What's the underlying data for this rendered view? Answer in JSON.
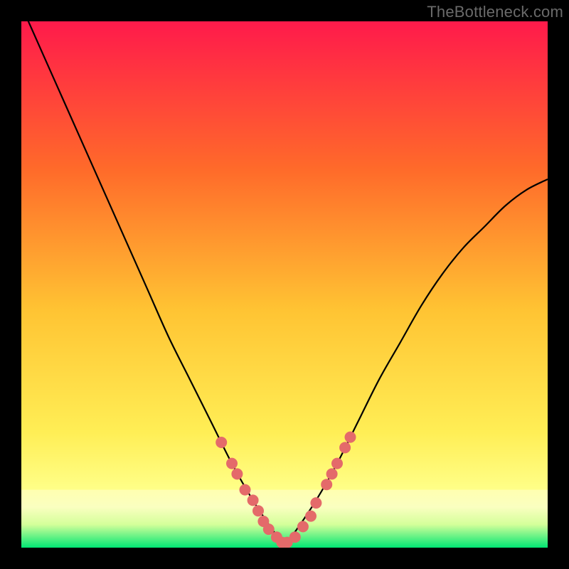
{
  "watermark": "TheBottleneck.com",
  "chart_data": {
    "type": "line",
    "title": "",
    "xlabel": "",
    "ylabel": "",
    "xlim": [
      0,
      100
    ],
    "ylim": [
      0,
      100
    ],
    "background_gradient": {
      "top": "#ff1a4b",
      "mid1": "#ff7a2a",
      "mid2": "#ffd633",
      "mid3": "#ffff66",
      "bottom": "#00e673"
    },
    "series": [
      {
        "name": "bottleneck-curve",
        "x": [
          0,
          4,
          8,
          12,
          16,
          20,
          24,
          28,
          32,
          36,
          40,
          44,
          48,
          50,
          52,
          56,
          60,
          64,
          68,
          72,
          76,
          80,
          84,
          88,
          92,
          96,
          100
        ],
        "y": [
          103,
          94,
          85,
          76,
          67,
          58,
          49,
          40,
          32,
          24,
          16,
          9,
          3,
          0.5,
          3,
          9,
          16,
          24,
          32,
          39,
          46,
          52,
          57,
          61,
          65,
          68,
          70
        ]
      }
    ],
    "markers": {
      "name": "highlight-points",
      "color": "#e46a6a",
      "radius": 8,
      "points": [
        {
          "x": 38,
          "y": 20
        },
        {
          "x": 40,
          "y": 16
        },
        {
          "x": 41,
          "y": 14
        },
        {
          "x": 42.5,
          "y": 11
        },
        {
          "x": 44,
          "y": 9
        },
        {
          "x": 45,
          "y": 7
        },
        {
          "x": 46,
          "y": 5
        },
        {
          "x": 47,
          "y": 3.5
        },
        {
          "x": 48.5,
          "y": 2
        },
        {
          "x": 49.5,
          "y": 1
        },
        {
          "x": 50.5,
          "y": 1
        },
        {
          "x": 52,
          "y": 2
        },
        {
          "x": 53.5,
          "y": 4
        },
        {
          "x": 55,
          "y": 6
        },
        {
          "x": 56,
          "y": 8.5
        },
        {
          "x": 58,
          "y": 12
        },
        {
          "x": 59,
          "y": 14
        },
        {
          "x": 60,
          "y": 16
        },
        {
          "x": 61.5,
          "y": 19
        },
        {
          "x": 62.5,
          "y": 21
        }
      ]
    },
    "bottom_band": {
      "y_top": 11,
      "y_bottom": 0,
      "color_top": "#ffff99",
      "color_bottom": "#00e673"
    }
  }
}
